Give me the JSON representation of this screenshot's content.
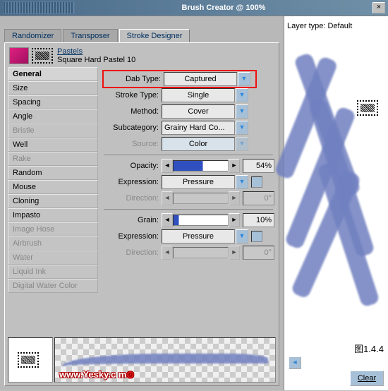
{
  "title": "Brush Creator @ 100%",
  "tabs": [
    "Randomizer",
    "Transposer",
    "Stroke Designer"
  ],
  "brush": {
    "category": "Pastels",
    "name": "Square Hard Pastel 10"
  },
  "categories": [
    {
      "label": "General",
      "active": true,
      "disabled": false
    },
    {
      "label": "Size",
      "active": false,
      "disabled": false
    },
    {
      "label": "Spacing",
      "active": false,
      "disabled": false
    },
    {
      "label": "Angle",
      "active": false,
      "disabled": false
    },
    {
      "label": "Bristle",
      "active": false,
      "disabled": true
    },
    {
      "label": "Well",
      "active": false,
      "disabled": false
    },
    {
      "label": "Rake",
      "active": false,
      "disabled": true
    },
    {
      "label": "Random",
      "active": false,
      "disabled": false
    },
    {
      "label": "Mouse",
      "active": false,
      "disabled": false
    },
    {
      "label": "Cloning",
      "active": false,
      "disabled": false
    },
    {
      "label": "Impasto",
      "active": false,
      "disabled": false
    },
    {
      "label": "Image Hose",
      "active": false,
      "disabled": true
    },
    {
      "label": "Airbrush",
      "active": false,
      "disabled": true
    },
    {
      "label": "Water",
      "active": false,
      "disabled": true
    },
    {
      "label": "Liquid Ink",
      "active": false,
      "disabled": true
    },
    {
      "label": "Digital Water Color",
      "active": false,
      "disabled": true
    }
  ],
  "general": {
    "dab_type_label": "Dab Type:",
    "dab_type": "Captured",
    "stroke_type_label": "Stroke Type:",
    "stroke_type": "Single",
    "method_label": "Method:",
    "method": "Cover",
    "subcat_label": "Subcategory:",
    "subcat": "Grainy Hard Co...",
    "source_label": "Source:",
    "source": "Color",
    "opacity_label": "Opacity:",
    "opacity": "54%",
    "expression_label": "Expression:",
    "expression": "Pressure",
    "direction_label": "Direction:",
    "direction": "0°",
    "grain_label": "Grain:",
    "grain": "10%",
    "expression2": "Pressure",
    "direction2": "0°"
  },
  "layer_type_label": "Layer type:",
  "layer_type": "Default",
  "figure_label": "图1.4.4",
  "clear_btn": "Clear",
  "watermark": "www.Yesky.c  m"
}
